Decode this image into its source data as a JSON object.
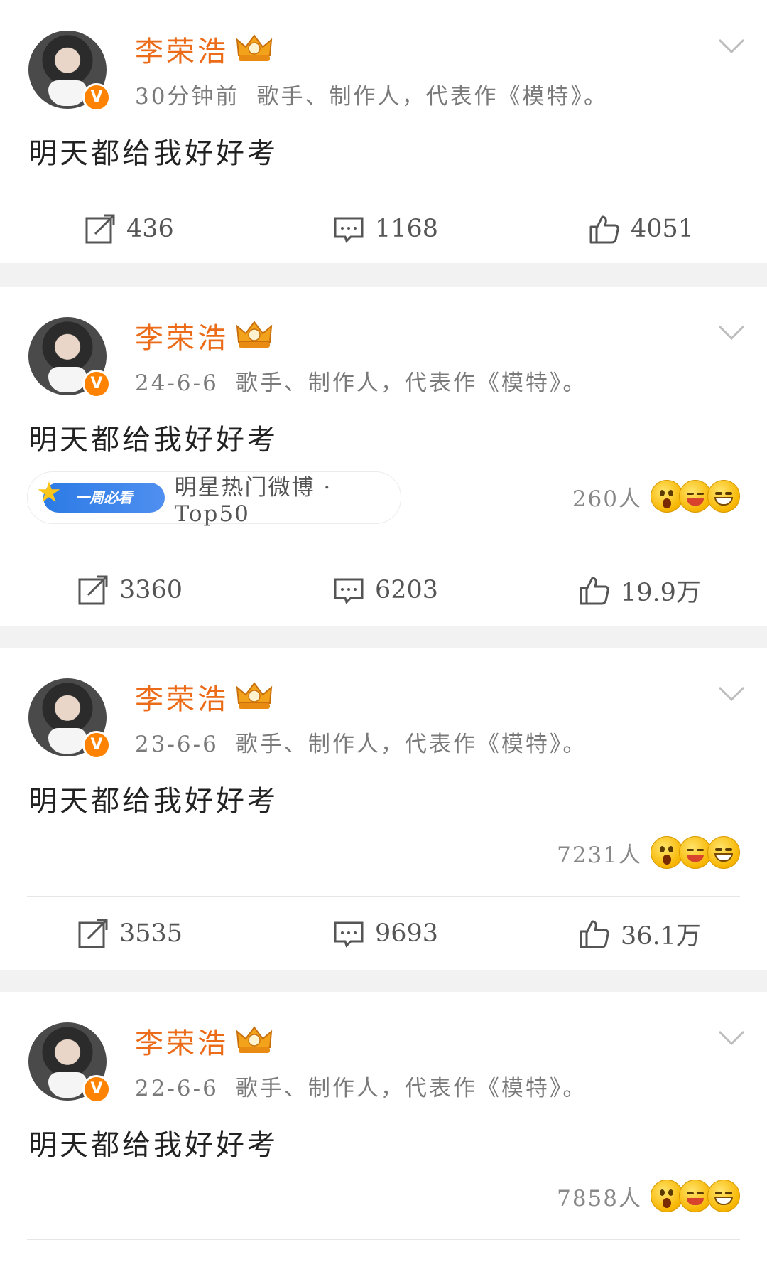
{
  "colors": {
    "name": "#eb6b18",
    "verified_badge": "#ff8200",
    "hot_tag": "#2c7be5"
  },
  "posts": [
    {
      "author": "李荣浩",
      "verified_mark": "V",
      "time": "30分钟前",
      "bio": "歌手、制作人，代表作《模特》。",
      "content": "明天都给我好好考",
      "repost": "436",
      "comment": "1168",
      "like": "4051"
    },
    {
      "author": "李荣浩",
      "verified_mark": "V",
      "time": "24-6-6",
      "bio": "歌手、制作人，代表作《模特》。",
      "content": "明天都给我好好考",
      "hot_tag": "一周必看",
      "hot_text": "明星热门微博 · Top50",
      "reaction_count": "260人",
      "repost": "3360",
      "comment": "6203",
      "like": "19.9万"
    },
    {
      "author": "李荣浩",
      "verified_mark": "V",
      "time": "23-6-6",
      "bio": "歌手、制作人，代表作《模特》。",
      "content": "明天都给我好好考",
      "reaction_count": "7231人",
      "repost": "3535",
      "comment": "9693",
      "like": "36.1万"
    },
    {
      "author": "李荣浩",
      "verified_mark": "V",
      "time": "22-6-6",
      "bio": "歌手、制作人，代表作《模特》。",
      "content": "明天都给我好好考",
      "reaction_count": "7858人"
    }
  ],
  "icons": {
    "repost": "repost-icon",
    "comment": "comment-icon",
    "like": "like-icon",
    "more": "chevron-down-icon",
    "crown": "crown-badge-icon",
    "reactions": [
      "surprised-emoji-icon",
      "laughing-emoji-icon",
      "grinning-emoji-icon"
    ]
  }
}
